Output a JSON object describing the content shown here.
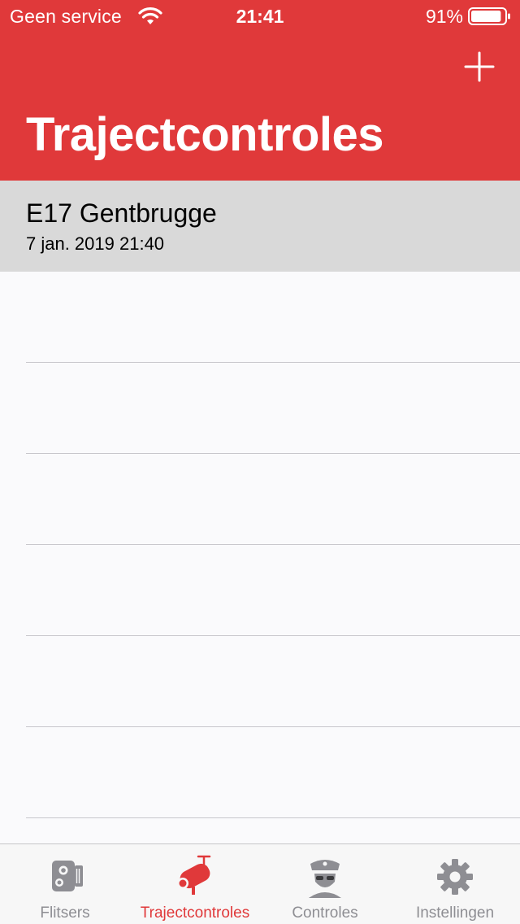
{
  "status_bar": {
    "carrier": "Geen service",
    "time": "21:41",
    "battery_percent": "91%",
    "battery_level": 0.91
  },
  "nav": {
    "title": "Trajectcontroles",
    "add_icon": "plus-icon"
  },
  "list": {
    "items": [
      {
        "title": "E17 Gentbrugge",
        "subtitle": "7 jan. 2019 21:40"
      }
    ]
  },
  "tab_bar": {
    "tabs": [
      {
        "label": "Flitsers",
        "icon": "speed-camera-icon",
        "active": false
      },
      {
        "label": "Trajectcontroles",
        "icon": "cctv-camera-icon",
        "active": true
      },
      {
        "label": "Controles",
        "icon": "police-officer-icon",
        "active": false
      },
      {
        "label": "Instellingen",
        "icon": "gear-icon",
        "active": false
      }
    ]
  },
  "colors": {
    "accent": "#e0393a",
    "selected_row": "#d9d9d9",
    "inactive_tab": "#8e8e93"
  }
}
